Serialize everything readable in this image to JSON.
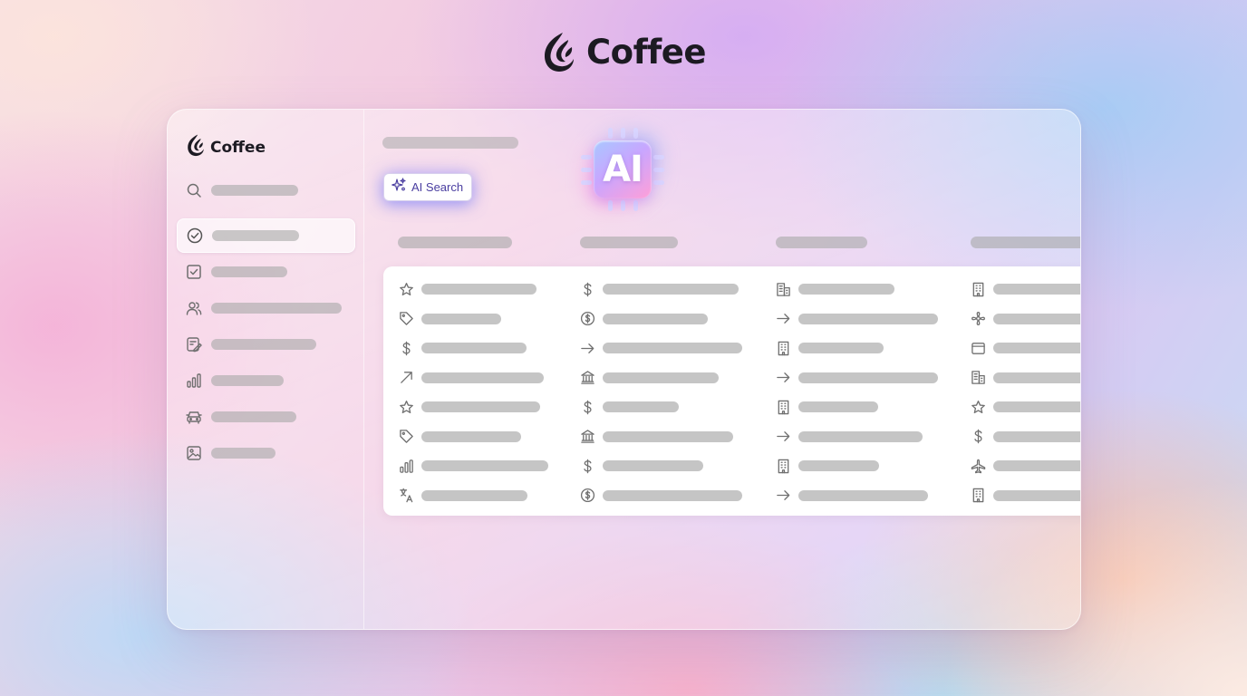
{
  "brand": {
    "name": "Coffee",
    "logo_icon": "flame-leaf-logo-icon"
  },
  "sidebar": {
    "brand_name": "Coffee",
    "items": [
      {
        "icon": "search-icon",
        "active": false
      },
      {
        "icon": "check-circle-icon",
        "active": true
      },
      {
        "icon": "checkbox-icon",
        "active": false
      },
      {
        "icon": "users-icon",
        "active": false
      },
      {
        "icon": "edit-doc-icon",
        "active": false
      },
      {
        "icon": "bar-chart-icon",
        "active": false
      },
      {
        "icon": "car-icon",
        "active": false
      },
      {
        "icon": "image-icon",
        "active": false
      }
    ]
  },
  "main": {
    "ai_search": {
      "label": "AI Search",
      "icon": "sparkles-icon"
    },
    "ai_badge": {
      "text": "AI",
      "icon": "ai-chip-icon"
    },
    "table": {
      "columns": 4,
      "rows": [
        [
          "star-icon",
          "dollar-icon",
          "buildings-icon",
          "building-icon"
        ],
        [
          "tag-icon",
          "dollar-circle-icon",
          "arrow-right-icon",
          "flower-icon"
        ],
        [
          "dollar-icon",
          "arrow-right-icon",
          "building-icon",
          "browser-icon"
        ],
        [
          "arrow-up-right-icon",
          "bank-icon",
          "arrow-right-icon",
          "buildings-icon"
        ],
        [
          "star-icon",
          "dollar-icon",
          "building-icon",
          "star-icon"
        ],
        [
          "tag-icon",
          "bank-icon",
          "arrow-right-icon",
          "dollar-icon"
        ],
        [
          "bar-chart-icon",
          "dollar-icon",
          "building-icon",
          "plane-icon"
        ],
        [
          "translate-icon",
          "dollar-circle-icon",
          "arrow-right-icon",
          "building-icon"
        ]
      ]
    }
  },
  "colors": {
    "brand_text": "#1c1a22",
    "ai_search_text": "#4a3ea0",
    "placeholder_bar": "#aaaaaa",
    "icon_stroke": "#707070"
  }
}
